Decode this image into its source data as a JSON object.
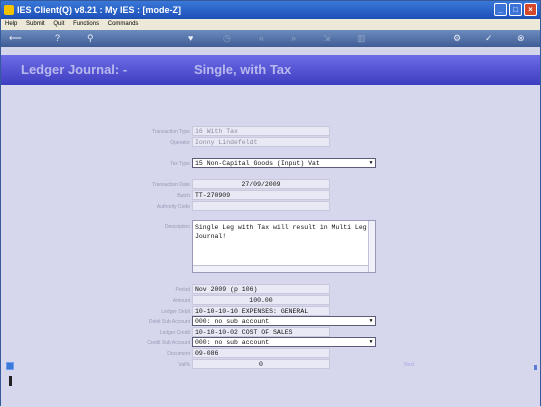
{
  "window": {
    "title": "IES Client(Q) v8.21 : My IES :      [mode-Z]"
  },
  "menu": [
    "Help",
    "Submit",
    "Quit",
    "Functions",
    "Commands"
  ],
  "header": {
    "left": "Ledger Journal: -",
    "right": "Single, with Tax"
  },
  "form": {
    "transaction_type_label": "Transaction Type",
    "transaction_type_value": "16 With Tax",
    "operator_label": "Operator",
    "operator_value": "Ionny Lindefeldt",
    "tax_type_label": "Tax Type",
    "tax_type_value": "15 Non-Capital Goods (Input) Vat",
    "transaction_date_label": "Transaction Date",
    "transaction_date_value": "27/09/2009",
    "batch_label": "Batch",
    "batch_value": "TT-270909",
    "authority_code_label": "Authority Code",
    "authority_code_value": "",
    "description_label": "Description",
    "description_value": "Single Leg with Tax will result in Multi Leg Journal!",
    "period_label": "Period",
    "period_value": "Nov 2009 (p 106)",
    "amount_label": "Amount",
    "amount_value": "100.00",
    "ledger_debit_label": "Ledger Debit",
    "ledger_debit_value": "10-10-10-10 EXPENSES: GENERAL",
    "debit_sub_account_label": "Debit Sub Account",
    "debit_sub_account_value": "000: no sub account",
    "ledger_credit_label": "Ledger Credit",
    "ledger_credit_value": "10-10-10-02 COST OF SALES",
    "credit_sub_account_label": "Credit Sub Account",
    "credit_sub_account_value": "000: no sub account",
    "document_label": "Document",
    "document_value": "09-086",
    "vat_label": "Vat%",
    "vat_value": "0"
  },
  "next_link": "Next",
  "colors": {
    "header_bg": "#4b4bd0",
    "title_bar": "#2a62c9",
    "accent": "#6d6de8"
  }
}
